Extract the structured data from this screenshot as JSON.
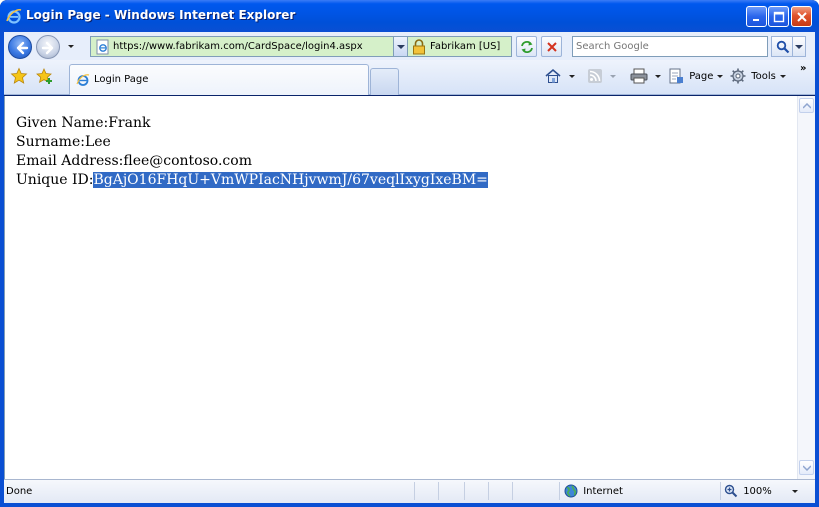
{
  "window": {
    "title": "Login Page - Windows Internet Explorer",
    "app_icon": "ie-icon"
  },
  "nav": {
    "back_icon": "back-arrow-icon",
    "forward_icon": "forward-arrow-icon",
    "address_url": "https://www.fabrikam.com/CardSpace/login4.aspx",
    "certificate_label": "Fabrikam [US]",
    "search_placeholder": "Search Google"
  },
  "tabs": {
    "active_label": "Login Page"
  },
  "commands": {
    "page_label": "Page",
    "tools_label": "Tools"
  },
  "content": {
    "given_name_label": "Given Name:",
    "given_name_value": "Frank",
    "surname_label": "Surname:",
    "surname_value": "Lee",
    "email_label": "Email Address:",
    "email_value": "flee@contoso.com",
    "unique_id_label": "Unique ID:",
    "unique_id_value": "BgAjO16FHqU+VmWPIacNHjvwmJ/67veqlIxygIxeBM="
  },
  "statusbar": {
    "status": "Done",
    "zone": "Internet",
    "zoom": "100%"
  },
  "colors": {
    "titlebar": "#0054e3",
    "secure_address_bg": "#d5f0c9",
    "selection": "#316ac5"
  }
}
